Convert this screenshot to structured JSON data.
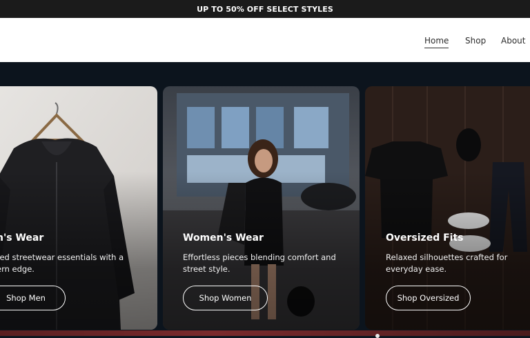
{
  "promo": {
    "text": "UP TO 50% OFF SELECT STYLES"
  },
  "nav": {
    "items": [
      {
        "label": "Home",
        "active": true
      },
      {
        "label": "Shop",
        "active": false
      },
      {
        "label": "About",
        "active": false
      }
    ]
  },
  "cards": [
    {
      "title": "n's Wear",
      "desc_line1": "red streetwear essentials with a",
      "desc_line2": "ern edge.",
      "button": "Shop Men"
    },
    {
      "title": "Women's Wear",
      "desc_line1": "Effortless pieces blending comfort and",
      "desc_line2": "street style.",
      "button": "Shop Women"
    },
    {
      "title": "Oversized Fits",
      "desc_line1": "Relaxed silhouettes crafted for",
      "desc_line2": "everyday ease.",
      "button": "Shop Oversized"
    }
  ],
  "icons": {
    "hoodie": "hoodie-image",
    "street": "street-model-image",
    "flatlay": "flatlay-image"
  }
}
